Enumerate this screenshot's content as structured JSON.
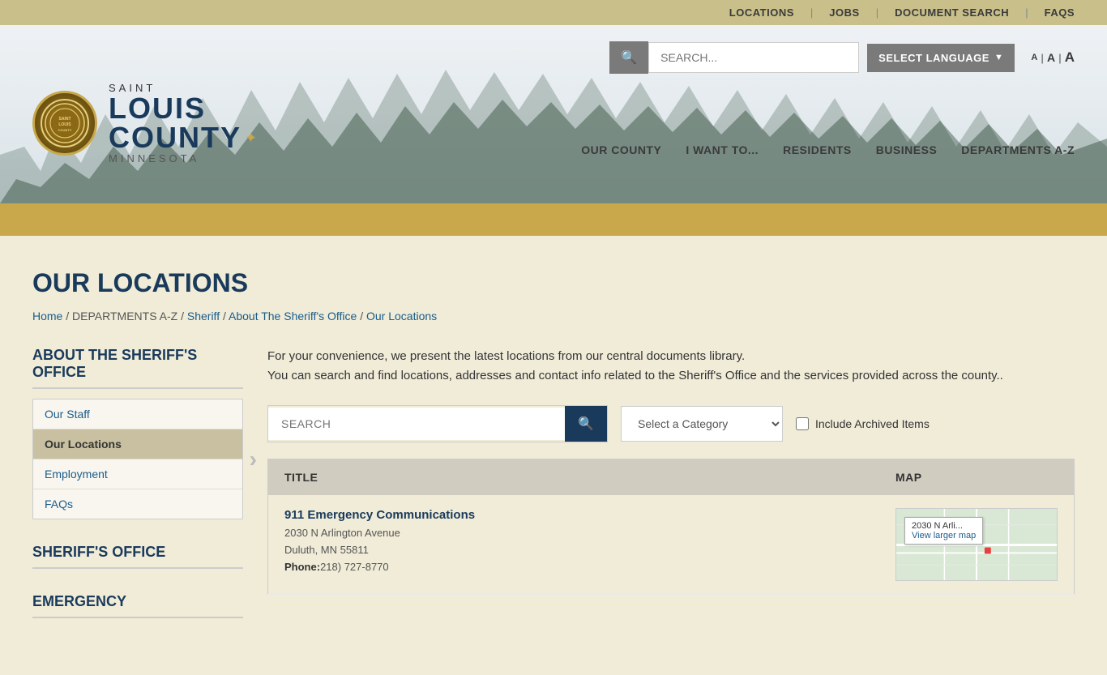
{
  "topbar": {
    "links": [
      {
        "label": "LOCATIONS",
        "href": "#"
      },
      {
        "label": "JOBS",
        "href": "#"
      },
      {
        "label": "DOCUMENT SEARCH",
        "href": "#"
      },
      {
        "label": "FAQS",
        "href": "#"
      }
    ]
  },
  "header": {
    "search_placeholder": "SEARCH...",
    "lang_button": "SELECT LANGUAGE",
    "font_sizes": [
      "A",
      "A",
      "A"
    ],
    "logo": {
      "saint": "SAINT",
      "louis": "LOUIS",
      "county": "COUNTY",
      "minnesota": "MINNESOTA",
      "seal_text": "SAINT LOUIS"
    },
    "nav": [
      {
        "label": "OUR COUNTY"
      },
      {
        "label": "I WANT TO..."
      },
      {
        "label": "RESIDENTS"
      },
      {
        "label": "BUSINESS"
      },
      {
        "label": "DEPARTMENTS A-Z"
      }
    ]
  },
  "page": {
    "title": "OUR LOCATIONS",
    "breadcrumb": [
      {
        "label": "Home",
        "href": "#"
      },
      {
        "label": "DEPARTMENTS A-Z",
        "href": "#",
        "plain": true
      },
      {
        "label": "Sheriff",
        "href": "#"
      },
      {
        "label": "About The Sheriff's Office",
        "href": "#"
      },
      {
        "label": "Our Locations",
        "href": "#"
      }
    ]
  },
  "sidebar": {
    "about_heading": "ABOUT THE SHERIFF'S OFFICE",
    "items": [
      {
        "label": "Our Staff",
        "active": false
      },
      {
        "label": "Our Locations",
        "active": true
      },
      {
        "label": "Employment",
        "active": false
      },
      {
        "label": "FAQs",
        "active": false
      }
    ],
    "sheriffs_heading": "SHERIFF'S OFFICE",
    "emergency_heading": "EMERGENCY"
  },
  "main": {
    "intro_line1": "For your convenience, we present the latest locations from our central documents library.",
    "intro_line2": "You can search and find locations, addresses and contact info related to the Sheriff's Office and the services provided across the county..",
    "search_placeholder": "SEARCH",
    "category_label": "Select a Category",
    "category_options": [
      "Select a Category"
    ],
    "archive_label": "Include Archived Items",
    "table": {
      "col_title": "TITLE",
      "col_map": "MAP",
      "rows": [
        {
          "title": "911 Emergency Communications",
          "address_line1": "2030 N Arlington Avenue",
          "address_line2": "Duluth, MN 55811",
          "phone_label": "Phone:(",
          "phone": "218) 727-8770",
          "map_address_short": "2030 N Arli...",
          "map_link_label": "View larger map"
        }
      ]
    }
  }
}
